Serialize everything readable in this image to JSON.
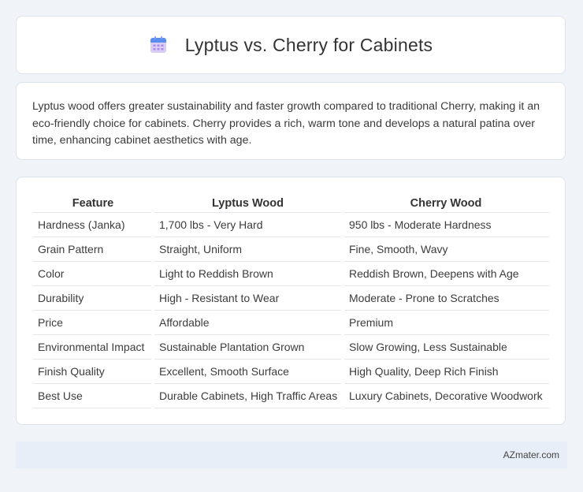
{
  "header": {
    "title": "Lyptus vs. Cherry for Cabinets",
    "icon": "calendar-icon"
  },
  "description": {
    "text": "Lyptus wood offers greater sustainability and faster growth compared to traditional Cherry, making it an eco-friendly choice for cabinets. Cherry provides a rich, warm tone and develops a natural patina over time, enhancing cabinet aesthetics with age."
  },
  "table": {
    "headers": [
      "Feature",
      "Lyptus Wood",
      "Cherry Wood"
    ],
    "rows": [
      [
        "Hardness (Janka)",
        "1,700 lbs - Very Hard",
        "950 lbs - Moderate Hardness"
      ],
      [
        "Grain Pattern",
        "Straight, Uniform",
        "Fine, Smooth, Wavy"
      ],
      [
        "Color",
        "Light to Reddish Brown",
        "Reddish Brown, Deepens with Age"
      ],
      [
        "Durability",
        "High - Resistant to Wear",
        "Moderate - Prone to Scratches"
      ],
      [
        "Price",
        "Affordable",
        "Premium"
      ],
      [
        "Environmental Impact",
        "Sustainable Plantation Grown",
        "Slow Growing, Less Sustainable"
      ],
      [
        "Finish Quality",
        "Excellent, Smooth Surface",
        "High Quality, Deep Rich Finish"
      ],
      [
        "Best Use",
        "Durable Cabinets, High Traffic Areas",
        "Luxury Cabinets, Decorative Woodwork"
      ]
    ]
  },
  "footer": {
    "brand": "AZmater.com"
  },
  "colors": {
    "background": "#f0f3f8",
    "card": "#ffffff",
    "footer": "#e8eef8",
    "icon_top": "#5b8def",
    "icon_body": "#c9b3f5"
  }
}
